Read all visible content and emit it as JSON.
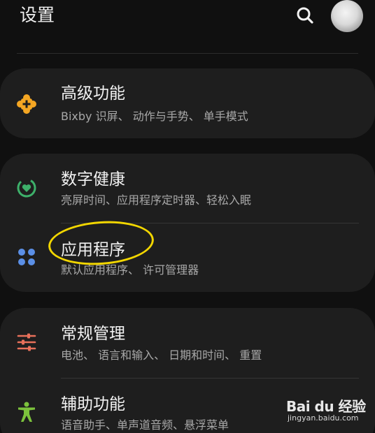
{
  "header": {
    "title": "设置",
    "search_icon": "search-icon",
    "avatar": "avatar"
  },
  "settings": {
    "advanced": {
      "title": "高级功能",
      "subtitle": "Bixby 识屏、 动作与手势、 单手模式",
      "icon": "puzzle-plus-icon",
      "icon_color": "#f4a623"
    },
    "digital_wellbeing": {
      "title": "数字健康",
      "subtitle": "亮屏时间、应用程序定时器、轻松入眠",
      "icon": "wellbeing-icon",
      "icon_color": "#3db06a"
    },
    "apps": {
      "title": "应用程序",
      "subtitle": "默认应用程序、 许可管理器",
      "icon": "apps-grid-icon",
      "icon_color": "#5b8fe6"
    },
    "general_management": {
      "title": "常规管理",
      "subtitle": "电池、 语言和输入、 日期和时间、 重置",
      "icon": "sliders-icon",
      "icon_color": "#e8705a"
    },
    "accessibility": {
      "title": "辅助功能",
      "subtitle": "语音助手、单声道音频、悬浮菜单",
      "icon": "accessibility-icon",
      "icon_color": "#7cc23c"
    }
  },
  "annotation": {
    "highlight_color": "#f2d600"
  },
  "watermark": {
    "logo": "Bai du 经验",
    "url": "jingyan.baidu.com"
  }
}
